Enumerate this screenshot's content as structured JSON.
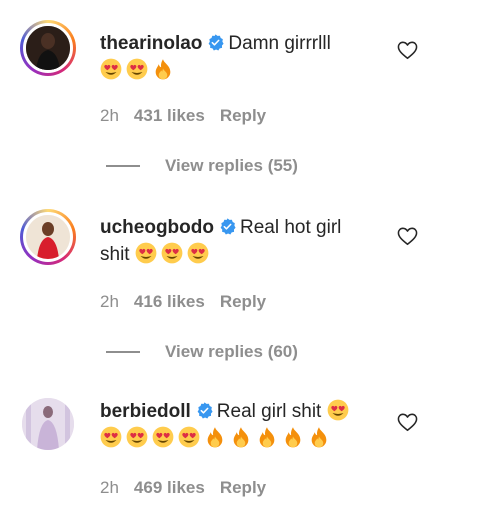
{
  "comments": [
    {
      "username": "thearinolao",
      "text": "Damn girrrlll",
      "emojis": [
        "heart-eyes-emoji",
        "heart-eyes-emoji",
        "fire-emoji"
      ],
      "time": "2h",
      "likes": "431 likes",
      "reply": "Reply",
      "view_replies": "View replies (55)"
    },
    {
      "username": "ucheogbodo",
      "text": "Real hot girl",
      "text_line2": "shit",
      "emojis": [
        "heart-eyes-emoji",
        "heart-eyes-emoji",
        "heart-eyes-emoji"
      ],
      "time": "2h",
      "likes": "416 likes",
      "reply": "Reply",
      "view_replies": "View replies (60)"
    },
    {
      "username": "berbiedoll",
      "text": "Real girl shit",
      "emojis": [
        "heart-eyes-emoji",
        "heart-eyes-emoji",
        "heart-eyes-emoji",
        "heart-eyes-emoji",
        "heart-eyes-emoji",
        "fire-emoji",
        "fire-emoji",
        "fire-emoji",
        "fire-emoji",
        "fire-emoji"
      ],
      "time": "2h",
      "likes": "469 likes",
      "reply": "Reply"
    }
  ],
  "colors": {
    "text": "#262626",
    "meta": "#8e8e8e",
    "verified": "#3897f0"
  }
}
